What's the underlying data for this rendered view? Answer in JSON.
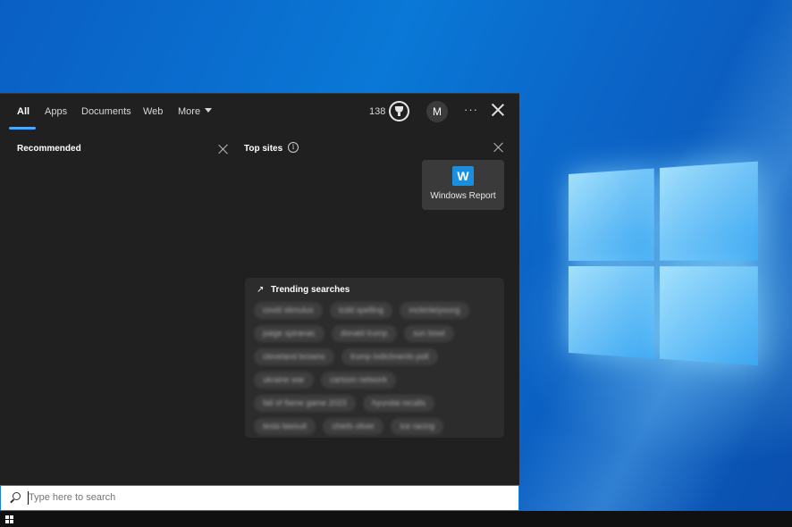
{
  "tabs": [
    {
      "label": "All"
    },
    {
      "label": "Apps"
    },
    {
      "label": "Documents"
    },
    {
      "label": "Web"
    },
    {
      "label": "More"
    }
  ],
  "header": {
    "points": "138",
    "avatar_initial": "M",
    "more_label": "···"
  },
  "recommended": {
    "title": "Recommended"
  },
  "top_sites": {
    "title": "Top sites",
    "info": "i",
    "sites": [
      {
        "logo": "W",
        "label": "Windows Report"
      }
    ]
  },
  "trending": {
    "arrow": "↗",
    "title": "Trending searches",
    "chips": [
      "covid stimulus",
      "tcdd spelling",
      "mckinleiyoung",
      "paige spiranac",
      "donald trump",
      "sun bowl",
      "cleveland browns",
      "trump indictments poll",
      "ukraine war",
      "cartoon network",
      "fall of flame game 2023",
      "hyundai recalls",
      "tesla lawsuit",
      "chiefs oliver",
      "ice racing"
    ]
  },
  "search": {
    "placeholder": "Type here to search"
  },
  "colors": {
    "accent": "#4aa8ff",
    "panel": "#202020",
    "tile": "#3a3a3a"
  }
}
